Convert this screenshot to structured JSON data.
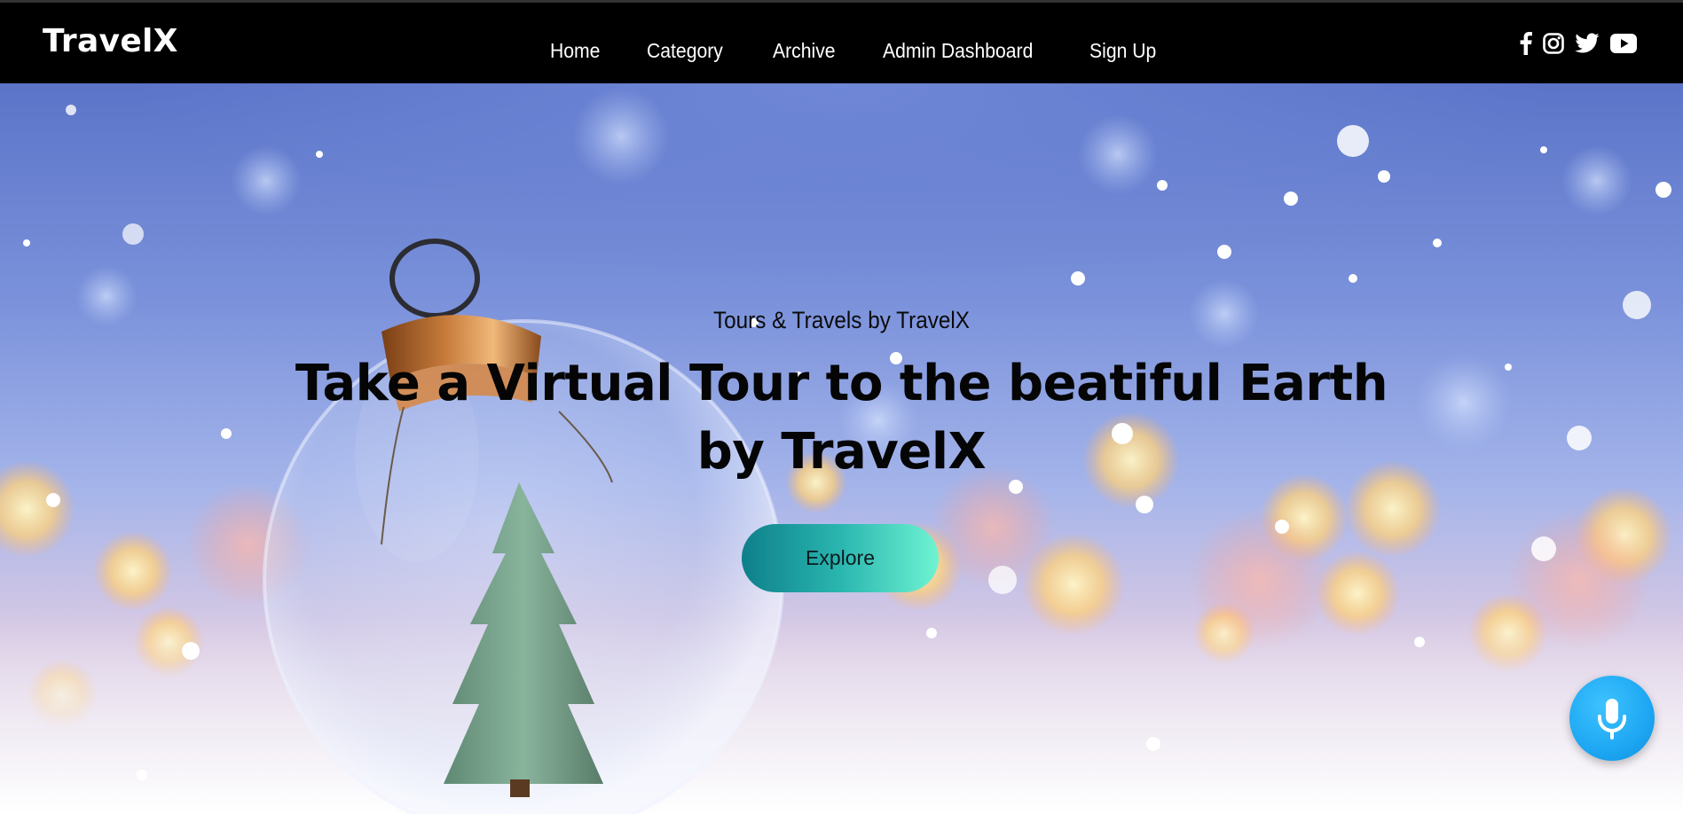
{
  "brand": {
    "name": "TravelX"
  },
  "nav": {
    "items": [
      {
        "label": "Home"
      },
      {
        "label": "Category"
      },
      {
        "label": "Archive"
      },
      {
        "label": "Admin Dashboard"
      },
      {
        "label": "Sign Up"
      }
    ]
  },
  "social": {
    "icons": [
      "facebook-icon",
      "instagram-icon",
      "twitter-icon",
      "youtube-icon"
    ]
  },
  "hero": {
    "subtitle": "Tours & Travels by TravelX",
    "headline": "Take a Virtual Tour to the beatiful Earth by TravelX",
    "cta_label": "Explore",
    "background": "snow-globe-christmas-tree-bokeh"
  },
  "voice": {
    "icon": "microphone-icon"
  },
  "colors": {
    "navbar_bg": "#000000",
    "cta_gradient_start": "#0e7f8a",
    "cta_gradient_end": "#6ff3d2",
    "mic_button": "#1ea7f3"
  }
}
